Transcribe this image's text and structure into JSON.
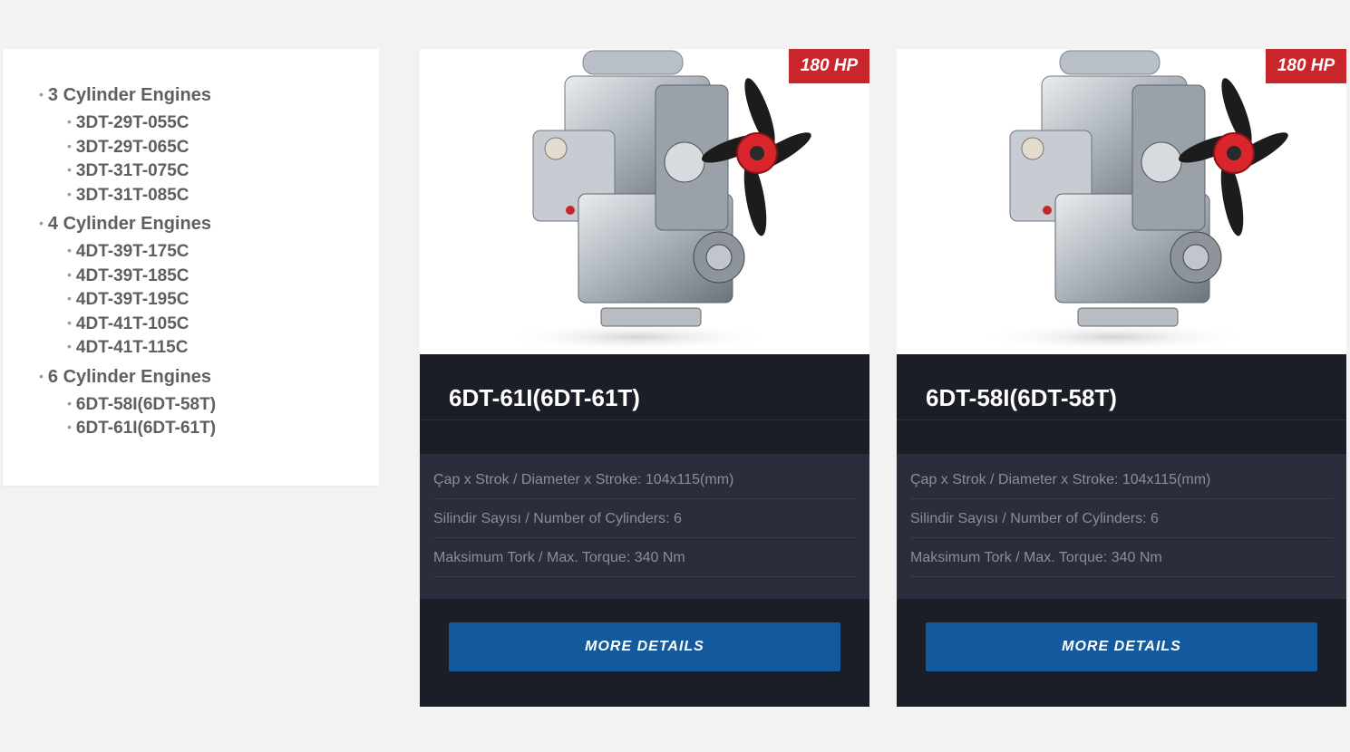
{
  "sidebar": {
    "categories": [
      {
        "label": "3 Cylinder Engines",
        "items": [
          "3DT-29T-055C",
          "3DT-29T-065C",
          "3DT-31T-075C",
          "3DT-31T-085C"
        ]
      },
      {
        "label": "4 Cylinder Engines",
        "items": [
          "4DT-39T-175C",
          "4DT-39T-185C",
          "4DT-39T-195C",
          "4DT-41T-105C",
          "4DT-41T-115C"
        ]
      },
      {
        "label": "6 Cylinder Engines",
        "items": [
          "6DT-58I(6DT-58T)",
          "6DT-61I(6DT-61T)"
        ]
      }
    ]
  },
  "cards": [
    {
      "badge": "180 HP",
      "title": "6DT-61I(6DT-61T)",
      "specs": [
        "Çap x Strok / Diameter x Stroke: 104x115(mm)",
        "Silindir Sayısı / Number of Cylinders: 6",
        "Maksimum Tork / Max. Torque: 340 Nm"
      ],
      "button": "MORE DETAILS"
    },
    {
      "badge": "180 HP",
      "title": "6DT-58I(6DT-58T)",
      "specs": [
        "Çap x Strok / Diameter x Stroke: 104x115(mm)",
        "Silindir Sayısı / Number of Cylinders: 6",
        "Maksimum Tork / Max. Torque: 340 Nm"
      ],
      "button": "MORE DETAILS"
    }
  ],
  "colors": {
    "background": "#f2f2f2",
    "card": "#1b1e27",
    "spec_panel": "#2a2d3b",
    "badge": "#c8252c",
    "button": "#13599e",
    "text_muted": "#8b8e99"
  },
  "icons": {
    "engine_image": "diesel-engine-photo"
  }
}
